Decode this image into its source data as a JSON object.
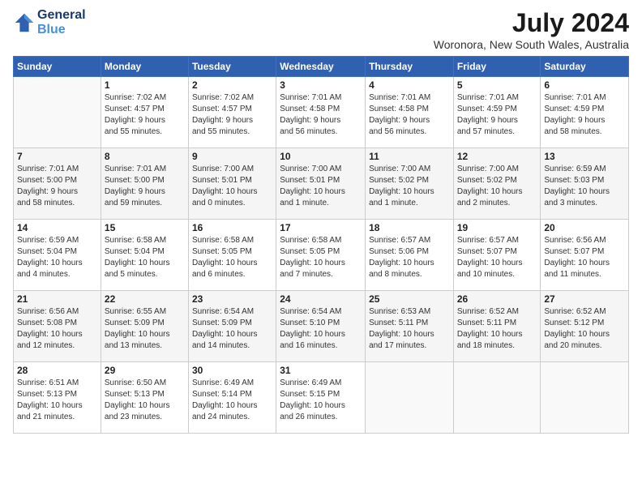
{
  "header": {
    "logo_line1": "General",
    "logo_line2": "Blue",
    "month": "July 2024",
    "location": "Woronora, New South Wales, Australia"
  },
  "weekdays": [
    "Sunday",
    "Monday",
    "Tuesday",
    "Wednesday",
    "Thursday",
    "Friday",
    "Saturday"
  ],
  "weeks": [
    [
      {
        "day": "",
        "info": ""
      },
      {
        "day": "1",
        "info": "Sunrise: 7:02 AM\nSunset: 4:57 PM\nDaylight: 9 hours\nand 55 minutes."
      },
      {
        "day": "2",
        "info": "Sunrise: 7:02 AM\nSunset: 4:57 PM\nDaylight: 9 hours\nand 55 minutes."
      },
      {
        "day": "3",
        "info": "Sunrise: 7:01 AM\nSunset: 4:58 PM\nDaylight: 9 hours\nand 56 minutes."
      },
      {
        "day": "4",
        "info": "Sunrise: 7:01 AM\nSunset: 4:58 PM\nDaylight: 9 hours\nand 56 minutes."
      },
      {
        "day": "5",
        "info": "Sunrise: 7:01 AM\nSunset: 4:59 PM\nDaylight: 9 hours\nand 57 minutes."
      },
      {
        "day": "6",
        "info": "Sunrise: 7:01 AM\nSunset: 4:59 PM\nDaylight: 9 hours\nand 58 minutes."
      }
    ],
    [
      {
        "day": "7",
        "info": "Sunrise: 7:01 AM\nSunset: 5:00 PM\nDaylight: 9 hours\nand 58 minutes."
      },
      {
        "day": "8",
        "info": "Sunrise: 7:01 AM\nSunset: 5:00 PM\nDaylight: 9 hours\nand 59 minutes."
      },
      {
        "day": "9",
        "info": "Sunrise: 7:00 AM\nSunset: 5:01 PM\nDaylight: 10 hours\nand 0 minutes."
      },
      {
        "day": "10",
        "info": "Sunrise: 7:00 AM\nSunset: 5:01 PM\nDaylight: 10 hours\nand 1 minute."
      },
      {
        "day": "11",
        "info": "Sunrise: 7:00 AM\nSunset: 5:02 PM\nDaylight: 10 hours\nand 1 minute."
      },
      {
        "day": "12",
        "info": "Sunrise: 7:00 AM\nSunset: 5:02 PM\nDaylight: 10 hours\nand 2 minutes."
      },
      {
        "day": "13",
        "info": "Sunrise: 6:59 AM\nSunset: 5:03 PM\nDaylight: 10 hours\nand 3 minutes."
      }
    ],
    [
      {
        "day": "14",
        "info": "Sunrise: 6:59 AM\nSunset: 5:04 PM\nDaylight: 10 hours\nand 4 minutes."
      },
      {
        "day": "15",
        "info": "Sunrise: 6:58 AM\nSunset: 5:04 PM\nDaylight: 10 hours\nand 5 minutes."
      },
      {
        "day": "16",
        "info": "Sunrise: 6:58 AM\nSunset: 5:05 PM\nDaylight: 10 hours\nand 6 minutes."
      },
      {
        "day": "17",
        "info": "Sunrise: 6:58 AM\nSunset: 5:05 PM\nDaylight: 10 hours\nand 7 minutes."
      },
      {
        "day": "18",
        "info": "Sunrise: 6:57 AM\nSunset: 5:06 PM\nDaylight: 10 hours\nand 8 minutes."
      },
      {
        "day": "19",
        "info": "Sunrise: 6:57 AM\nSunset: 5:07 PM\nDaylight: 10 hours\nand 10 minutes."
      },
      {
        "day": "20",
        "info": "Sunrise: 6:56 AM\nSunset: 5:07 PM\nDaylight: 10 hours\nand 11 minutes."
      }
    ],
    [
      {
        "day": "21",
        "info": "Sunrise: 6:56 AM\nSunset: 5:08 PM\nDaylight: 10 hours\nand 12 minutes."
      },
      {
        "day": "22",
        "info": "Sunrise: 6:55 AM\nSunset: 5:09 PM\nDaylight: 10 hours\nand 13 minutes."
      },
      {
        "day": "23",
        "info": "Sunrise: 6:54 AM\nSunset: 5:09 PM\nDaylight: 10 hours\nand 14 minutes."
      },
      {
        "day": "24",
        "info": "Sunrise: 6:54 AM\nSunset: 5:10 PM\nDaylight: 10 hours\nand 16 minutes."
      },
      {
        "day": "25",
        "info": "Sunrise: 6:53 AM\nSunset: 5:11 PM\nDaylight: 10 hours\nand 17 minutes."
      },
      {
        "day": "26",
        "info": "Sunrise: 6:52 AM\nSunset: 5:11 PM\nDaylight: 10 hours\nand 18 minutes."
      },
      {
        "day": "27",
        "info": "Sunrise: 6:52 AM\nSunset: 5:12 PM\nDaylight: 10 hours\nand 20 minutes."
      }
    ],
    [
      {
        "day": "28",
        "info": "Sunrise: 6:51 AM\nSunset: 5:13 PM\nDaylight: 10 hours\nand 21 minutes."
      },
      {
        "day": "29",
        "info": "Sunrise: 6:50 AM\nSunset: 5:13 PM\nDaylight: 10 hours\nand 23 minutes."
      },
      {
        "day": "30",
        "info": "Sunrise: 6:49 AM\nSunset: 5:14 PM\nDaylight: 10 hours\nand 24 minutes."
      },
      {
        "day": "31",
        "info": "Sunrise: 6:49 AM\nSunset: 5:15 PM\nDaylight: 10 hours\nand 26 minutes."
      },
      {
        "day": "",
        "info": ""
      },
      {
        "day": "",
        "info": ""
      },
      {
        "day": "",
        "info": ""
      }
    ]
  ]
}
